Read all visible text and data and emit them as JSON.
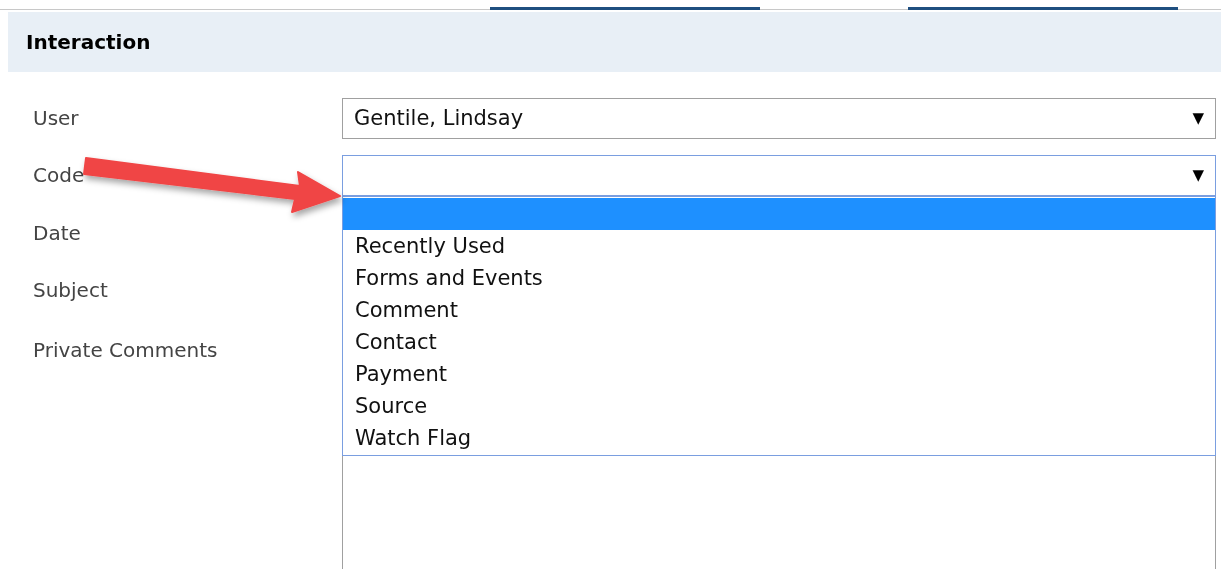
{
  "header": {
    "title": "Interaction"
  },
  "fields": [
    {
      "label": "User",
      "kind": "select",
      "value": "Gentile, Lindsay",
      "caret": "▼",
      "focused": false
    },
    {
      "label": "Code",
      "kind": "select",
      "caret": "▼",
      "focused": true,
      "expanded": true,
      "options": [
        {
          "selected": true
        },
        {
          "label": "Recently Used",
          "selected": false
        },
        {
          "label": "Forms and Events",
          "selected": false
        },
        {
          "label": "Comment",
          "selected": false
        },
        {
          "label": "Contact",
          "selected": false
        },
        {
          "label": "Payment",
          "selected": false
        },
        {
          "label": "Source",
          "selected": false
        },
        {
          "label": "Watch Flag",
          "selected": false
        }
      ]
    },
    {
      "label": "Date",
      "kind": "hidden"
    },
    {
      "label": "Subject",
      "kind": "hidden"
    },
    {
      "label": "Private Comments",
      "kind": "textarea"
    }
  ],
  "annotation": {
    "kind": "arrow"
  }
}
